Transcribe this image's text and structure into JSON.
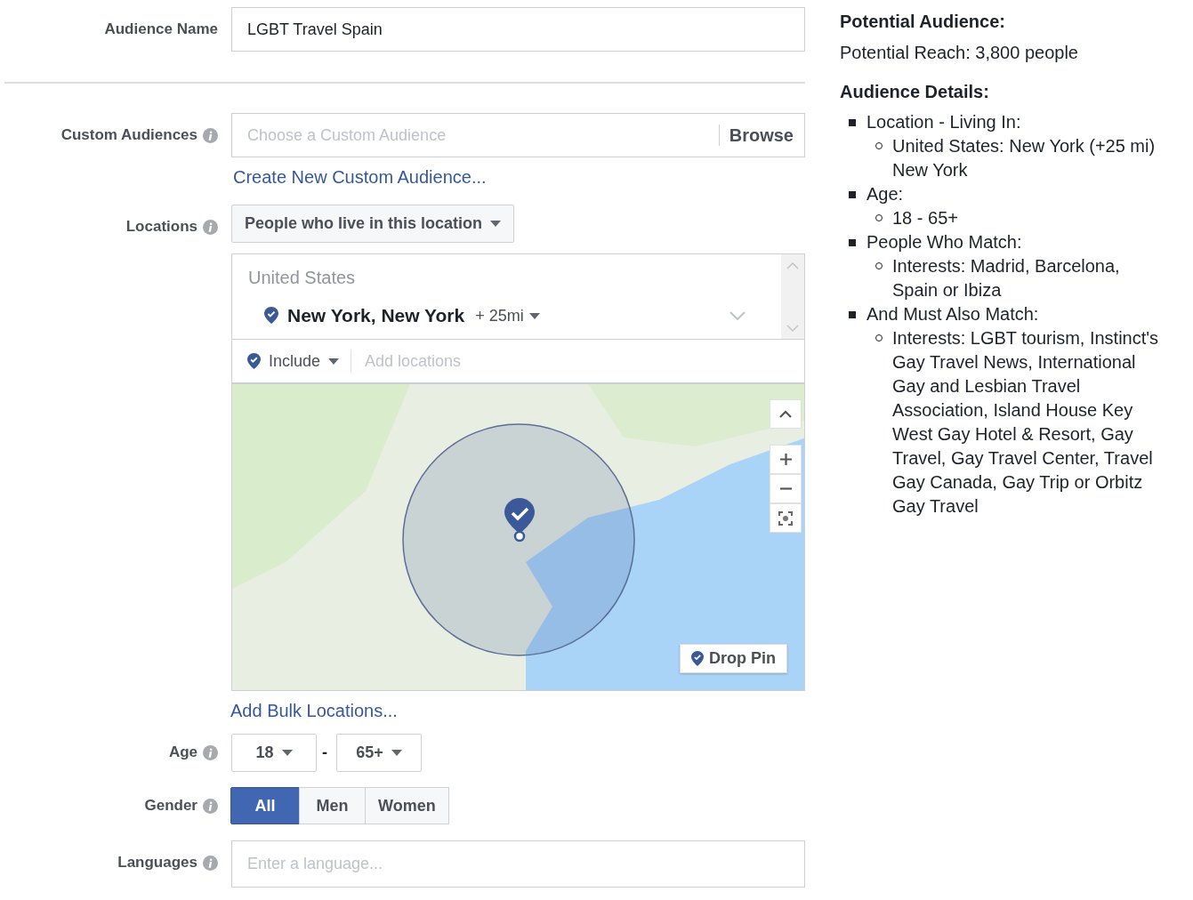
{
  "audience_name": {
    "label": "Audience Name",
    "value": "LGBT Travel Spain"
  },
  "custom_audiences": {
    "label": "Custom Audiences",
    "placeholder": "Choose a Custom Audience",
    "browse": "Browse",
    "create_link": "Create New Custom Audience..."
  },
  "locations": {
    "label": "Locations",
    "mode": "People who live in this location",
    "groups": [
      {
        "country": "United States",
        "items": [
          {
            "name": "New York, New York",
            "radius": "+ 25mi"
          }
        ]
      }
    ],
    "include": "Include",
    "add_placeholder": "Add locations",
    "drop_pin": "Drop Pin",
    "bulk_link": "Add Bulk Locations..."
  },
  "age": {
    "label": "Age",
    "min": "18",
    "separator": "-",
    "max": "65+"
  },
  "gender": {
    "label": "Gender",
    "options": [
      {
        "label": "All",
        "selected": true
      },
      {
        "label": "Men",
        "selected": false
      },
      {
        "label": "Women",
        "selected": false
      }
    ]
  },
  "languages": {
    "label": "Languages",
    "placeholder": "Enter a language..."
  },
  "summary": {
    "title": "Potential Audience:",
    "reach": "Potential Reach: 3,800 people",
    "details_title": "Audience Details:",
    "details": [
      {
        "text": "Location - Living In:",
        "children": [
          {
            "text": "United States: New York (+25 mi) New York"
          }
        ]
      },
      {
        "text": "Age:",
        "children": [
          {
            "text": "18 - 65+"
          }
        ]
      },
      {
        "text": "People Who Match:",
        "children": [
          {
            "text": "Interests: Madrid, Barcelona, Spain or Ibiza"
          }
        ]
      },
      {
        "text": "And Must Also Match:",
        "children": [
          {
            "text": "Interests: LGBT tourism, Instinct's Gay Travel News, International Gay and Lesbian Travel Association, Island House Key West Gay Hotel & Resort, Gay Travel, Gay Travel Center, Travel Gay Canada, Gay Trip or Orbitz Gay Travel"
          }
        ]
      }
    ]
  }
}
